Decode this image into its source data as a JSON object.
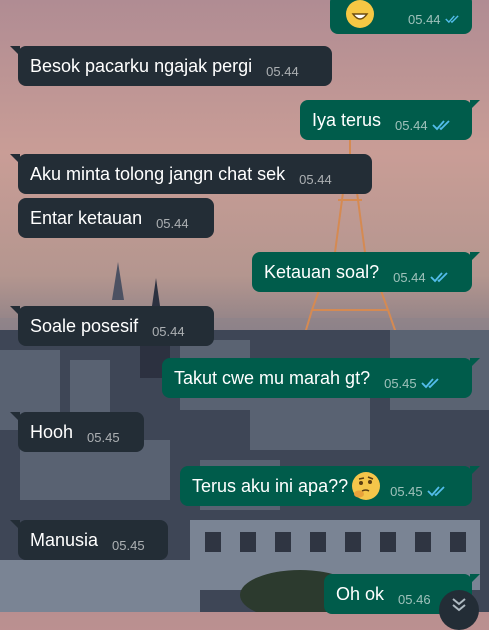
{
  "colors": {
    "incoming_bubble": "#232d36",
    "outgoing_bubble": "#005c4b",
    "read_ticks": "#53bdeb"
  },
  "messages": [
    {
      "text": "",
      "time": "05.44",
      "direction": "out",
      "status": "read",
      "emoji": "grinning-face"
    },
    {
      "text": "Besok pacarku ngajak pergi",
      "time": "05.44",
      "direction": "in"
    },
    {
      "text": "Iya terus",
      "time": "05.44",
      "direction": "out",
      "status": "read"
    },
    {
      "text": "Aku minta tolong jangn chat sek",
      "time": "05.44",
      "direction": "in"
    },
    {
      "text": "Entar ketauan",
      "time": "05.44",
      "direction": "in"
    },
    {
      "text": "Ketauan soal?",
      "time": "05.44",
      "direction": "out",
      "status": "read"
    },
    {
      "text": "Soale posesif",
      "time": "05.44",
      "direction": "in"
    },
    {
      "text": "Takut cwe mu marah gt?",
      "time": "05.45",
      "direction": "out",
      "status": "read"
    },
    {
      "text": "Hooh",
      "time": "05.45",
      "direction": "in"
    },
    {
      "text": "Terus aku ini apa??",
      "time": "05.45",
      "direction": "out",
      "status": "read",
      "emoji": "thinking-face"
    },
    {
      "text": "Manusia",
      "time": "05.45",
      "direction": "in"
    },
    {
      "text": "Oh ok",
      "time": "05.46",
      "direction": "out"
    }
  ],
  "scroll_down_icon": "double-chevron-down-icon"
}
